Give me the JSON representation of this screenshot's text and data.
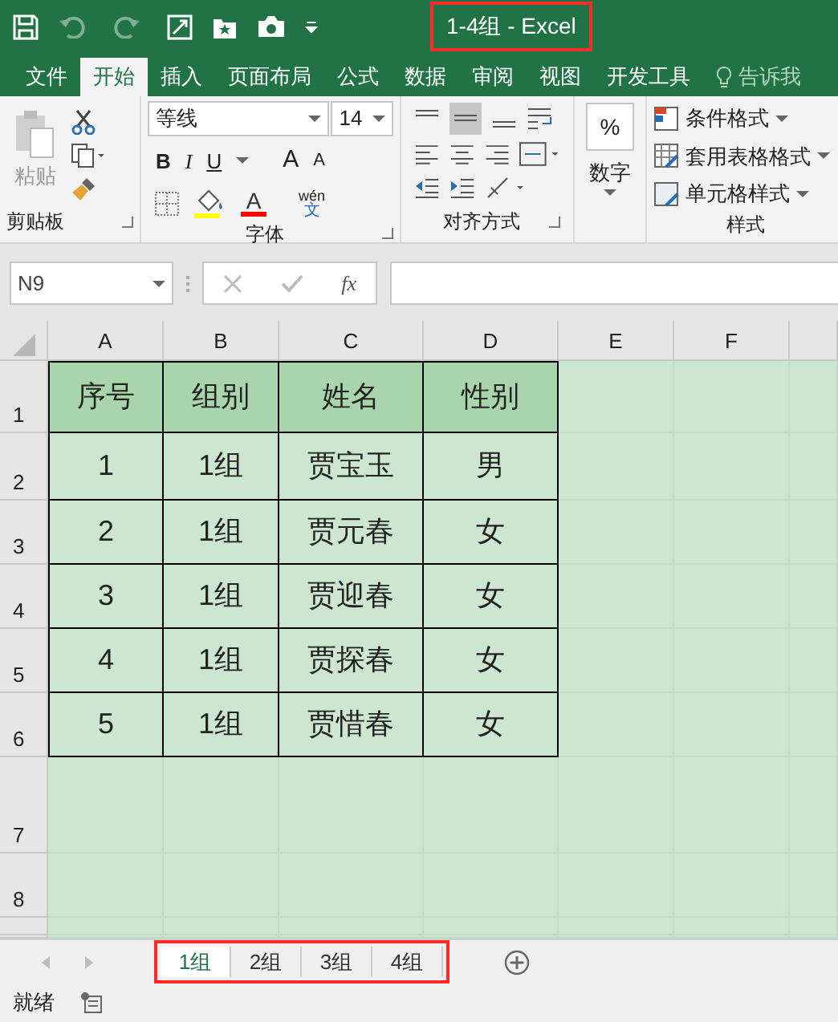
{
  "title": {
    "text": "1-4组 - Excel",
    "highlighted": true
  },
  "ribbon_tabs": [
    {
      "label": "文件",
      "selected": false
    },
    {
      "label": "开始",
      "selected": true
    },
    {
      "label": "插入",
      "selected": false
    },
    {
      "label": "页面布局",
      "selected": false
    },
    {
      "label": "公式",
      "selected": false
    },
    {
      "label": "数据",
      "selected": false
    },
    {
      "label": "审阅",
      "selected": false
    },
    {
      "label": "视图",
      "selected": false
    },
    {
      "label": "开发工具",
      "selected": false
    }
  ],
  "tell_me": "告诉我",
  "clipboard": {
    "paste": "粘贴",
    "label": "剪贴板"
  },
  "font": {
    "name": "等线",
    "size": "14",
    "styles": [
      "B",
      "I",
      "U"
    ],
    "grow": "A",
    "shrink": "A",
    "color_letter": "A",
    "phonetic_top": "wén",
    "phonetic_bottom": "文",
    "label": "字体"
  },
  "alignment": {
    "label": "对齐方式"
  },
  "number": {
    "symbol": "%",
    "label": "数字"
  },
  "styles": {
    "items": [
      "条件格式",
      "套用表格格式",
      "单元格样式"
    ],
    "label": "样式"
  },
  "name_box": "N9",
  "fx": "fx",
  "columns": [
    "A",
    "B",
    "C",
    "D",
    "E",
    "F"
  ],
  "row_numbers": [
    "1",
    "2",
    "3",
    "4",
    "5",
    "6",
    "7",
    "8"
  ],
  "table": {
    "header": [
      "序号",
      "组别",
      "姓名",
      "性别"
    ],
    "rows": [
      [
        "1",
        "1组",
        "贾宝玉",
        "男"
      ],
      [
        "2",
        "1组",
        "贾元春",
        "女"
      ],
      [
        "3",
        "1组",
        "贾迎春",
        "女"
      ],
      [
        "4",
        "1组",
        "贾探春",
        "女"
      ],
      [
        "5",
        "1组",
        "贾惜春",
        "女"
      ]
    ]
  },
  "sheet_tabs": {
    "highlighted": true,
    "tabs": [
      {
        "label": "1组",
        "selected": true
      },
      {
        "label": "2组",
        "selected": false
      },
      {
        "label": "3组",
        "selected": false
      },
      {
        "label": "4组",
        "selected": false
      }
    ]
  },
  "status": "就绪"
}
